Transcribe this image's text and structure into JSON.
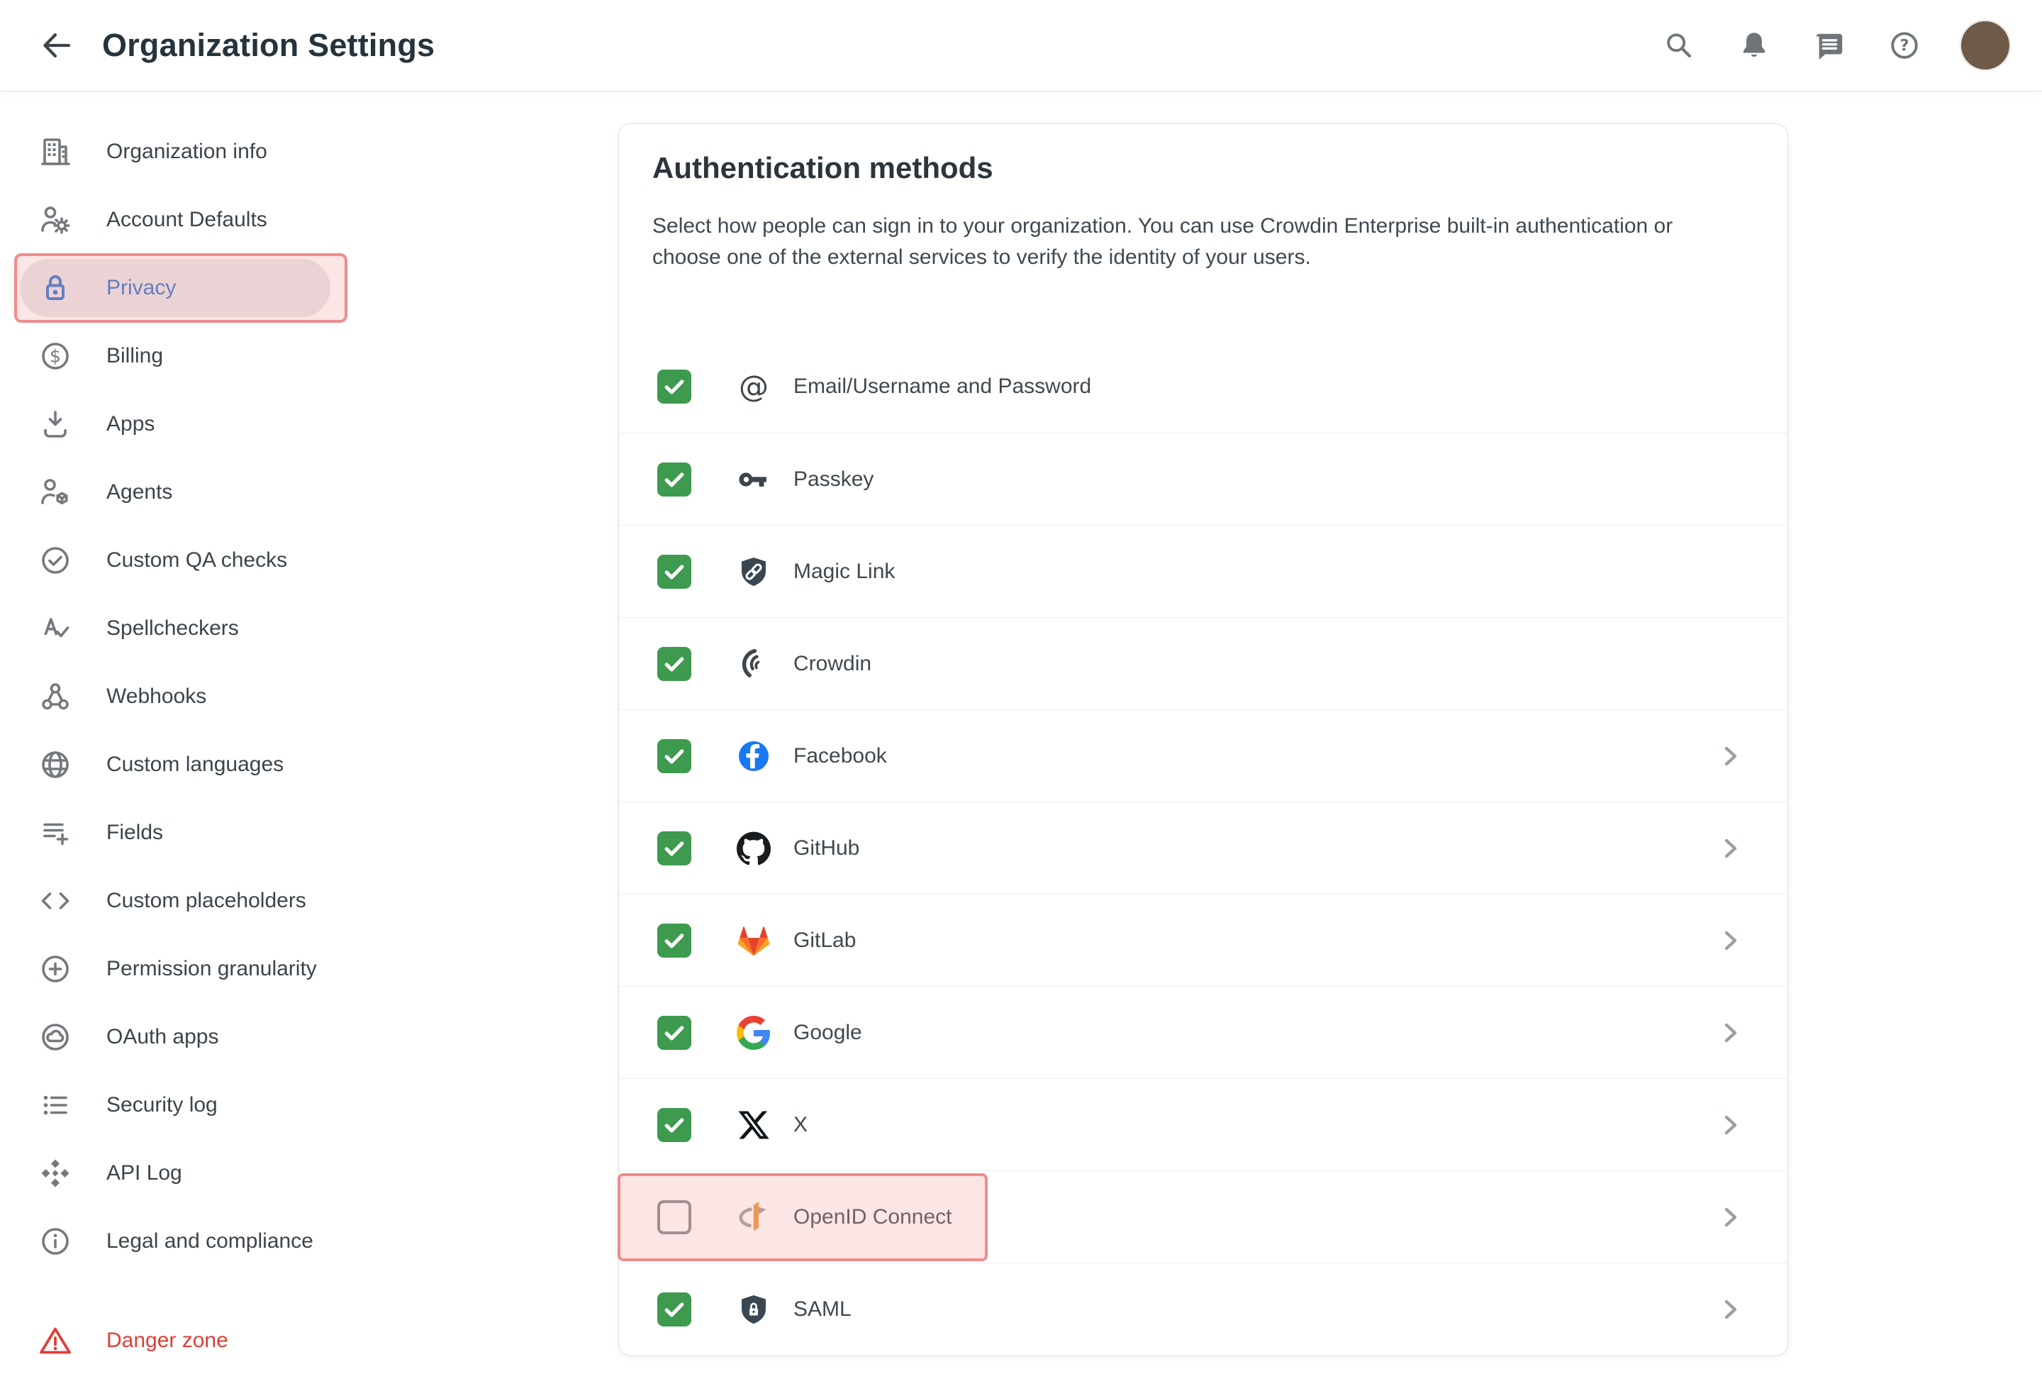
{
  "header": {
    "title": "Organization Settings",
    "actions": [
      "search",
      "notifications",
      "messages",
      "help",
      "avatar"
    ]
  },
  "sidebar": {
    "items": [
      {
        "label": "Organization info",
        "icon": "building"
      },
      {
        "label": "Account Defaults",
        "icon": "user-gear"
      },
      {
        "label": "Privacy",
        "icon": "lock",
        "active": true,
        "annotated": true
      },
      {
        "label": "Billing",
        "icon": "dollar-circle"
      },
      {
        "label": "Apps",
        "icon": "download"
      },
      {
        "label": "Agents",
        "icon": "user-cube"
      },
      {
        "label": "Custom QA checks",
        "icon": "check-circle"
      },
      {
        "label": "Spellcheckers",
        "icon": "spellcheck"
      },
      {
        "label": "Webhooks",
        "icon": "webhook"
      },
      {
        "label": "Custom languages",
        "icon": "globe"
      },
      {
        "label": "Fields",
        "icon": "list-add"
      },
      {
        "label": "Custom placeholders",
        "icon": "code"
      },
      {
        "label": "Permission granularity",
        "icon": "plus-circle"
      },
      {
        "label": "OAuth apps",
        "icon": "cloud-circle"
      },
      {
        "label": "Security log",
        "icon": "list"
      },
      {
        "label": "API Log",
        "icon": "api"
      },
      {
        "label": "Legal and compliance",
        "icon": "info-circle"
      },
      {
        "label": "Danger zone",
        "icon": "warning",
        "danger": true
      }
    ]
  },
  "main": {
    "title": "Authentication methods",
    "description": "Select how people can sign in to your organization. You can use Crowdin Enterprise built-in authentication or choose one of the external services to verify the identity of your users.",
    "methods": [
      {
        "label": "Email/Username and Password",
        "icon": "email",
        "checked": true,
        "chevron": false
      },
      {
        "label": "Passkey",
        "icon": "passkey",
        "checked": true,
        "chevron": false
      },
      {
        "label": "Magic Link",
        "icon": "magic-link",
        "checked": true,
        "chevron": false
      },
      {
        "label": "Crowdin",
        "icon": "crowdin",
        "checked": true,
        "chevron": false
      },
      {
        "label": "Facebook",
        "icon": "facebook",
        "checked": true,
        "chevron": true
      },
      {
        "label": "GitHub",
        "icon": "github",
        "checked": true,
        "chevron": true
      },
      {
        "label": "GitLab",
        "icon": "gitlab",
        "checked": true,
        "chevron": true
      },
      {
        "label": "Google",
        "icon": "google",
        "checked": true,
        "chevron": true
      },
      {
        "label": "X",
        "icon": "x",
        "checked": true,
        "chevron": true
      },
      {
        "label": "OpenID Connect",
        "icon": "openid",
        "checked": false,
        "chevron": true,
        "annotated": true
      },
      {
        "label": "SAML",
        "icon": "saml",
        "checked": true,
        "chevron": true
      }
    ]
  },
  "colors": {
    "checkbox_green": "#3d9a4e",
    "active_blue": "#2e71d0",
    "annotation_red": "#ee8484",
    "danger_red": "#e03e36",
    "facebook_blue": "#1877f2",
    "openid_orange": "#ed9434",
    "gitlab_orange": "#fc6d26",
    "icon_gray": "#75797d"
  }
}
